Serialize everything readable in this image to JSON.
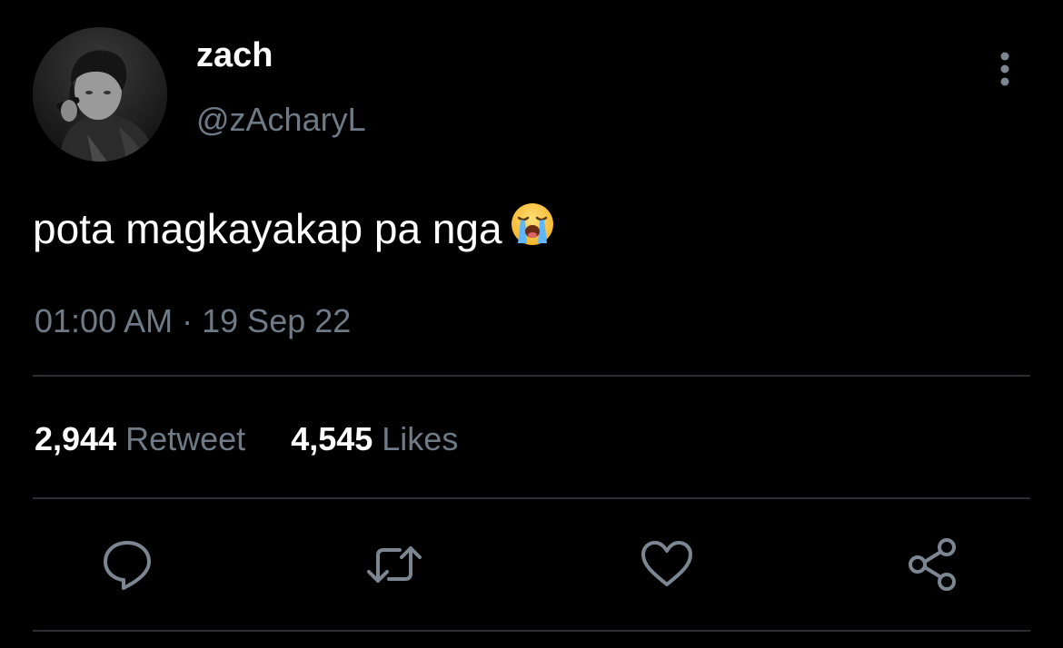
{
  "tweet": {
    "author": {
      "display_name": "zach",
      "handle": "@zAcharyL",
      "avatar": "avatar-photo"
    },
    "text": "pota magkayakap pa nga",
    "emoji": "loudly-crying-face-emoji",
    "time": "01:00 AM",
    "separator": "·",
    "date": "19 Sep 22",
    "stats": {
      "retweets_count": "2,944",
      "retweets_label": "Retweet",
      "likes_count": "4,545",
      "likes_label": "Likes"
    },
    "actions": {
      "reply": "reply-icon",
      "retweet": "retweet-icon",
      "like": "heart-icon",
      "share": "share-icon",
      "more": "more-vertical-icon"
    }
  },
  "colors": {
    "background": "#000000",
    "primary_text": "#ffffff",
    "secondary_text": "#6e7a86",
    "divider": "#2a2d31",
    "icon": "#7c8691"
  }
}
